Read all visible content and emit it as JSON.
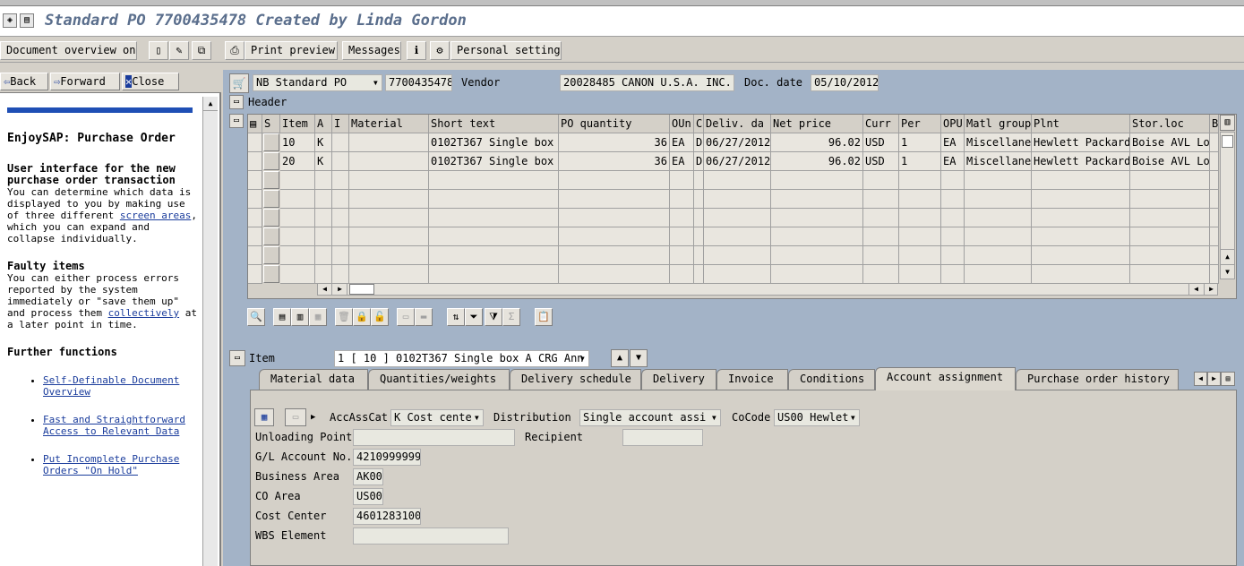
{
  "window": {
    "title": "Standard PO 7700435478 Created by Linda Gordon"
  },
  "toolbar": {
    "document_overview": "Document overview on",
    "print_preview": "Print preview",
    "messages": "Messages",
    "personal_setting": "Personal setting"
  },
  "helpnav": {
    "back": "Back",
    "forward": "Forward",
    "close": "Close"
  },
  "help": {
    "title": "EnjoySAP: Purchase Order",
    "s1_head": "User interface for the new purchase order transaction",
    "s1_text_a": "You can determine which data is displayed to you by making use of three different ",
    "s1_link": "screen areas",
    "s1_text_b": ", which you can expand and collapse individually.",
    "s2_head": "Faulty items",
    "s2_text_a": "You can either process errors reported by the system immediately or \"save them up\" and process them ",
    "s2_link": "collectively",
    "s2_text_b": " at a later point in time.",
    "s3_head": "Further functions",
    "links": [
      "Self-Definable Document Overview",
      "Fast and Straightforward Access to Relevant Data",
      "Put Incomplete Purchase Orders \"On Hold\""
    ]
  },
  "header": {
    "doc_type": "NB Standard PO",
    "po_number": "7700435478",
    "vendor_label": "Vendor",
    "vendor_value": "20028485 CANON U.S.A. INC.",
    "docdate_label": "Doc. date",
    "docdate_value": "05/10/2012",
    "header_label": "Header"
  },
  "grid": {
    "columns": [
      "S",
      "Item",
      "A",
      "I",
      "Material",
      "Short text",
      "PO quantity",
      "OUn",
      "C",
      "Deliv. da",
      "Net price",
      "Curr",
      "Per",
      "OPU",
      "Matl group",
      "Plnt",
      "Stor.loc",
      "B"
    ],
    "rows": [
      [
        "",
        "10",
        "K",
        "",
        "",
        "0102T367 Single box A",
        "36",
        "EA",
        "D",
        "06/27/2012",
        "96.02",
        "USD",
        "1",
        "EA",
        "Miscellaneo",
        "Hewlett Packard",
        "Boise AVL Loc",
        ""
      ],
      [
        "",
        "20",
        "K",
        "",
        "",
        "0102T367 Single box A",
        "36",
        "EA",
        "D",
        "06/27/2012",
        "96.02",
        "USD",
        "1",
        "EA",
        "Miscellaneo",
        "Hewlett Packard",
        "Boise AVL Loc",
        ""
      ]
    ]
  },
  "item": {
    "label": "Item",
    "selector": "1 [ 10 ] 0102T367 Single box A CRG Ann"
  },
  "tabs": [
    "Material data",
    "Quantities/weights",
    "Delivery schedule",
    "Delivery",
    "Invoice",
    "Conditions",
    "Account assignment",
    "Purchase order history"
  ],
  "account": {
    "accasscat_label": "AccAssCat",
    "accasscat_value": "K Cost cente",
    "distribution_label": "Distribution",
    "distribution_value": "Single account assi",
    "cocode_label": "CoCode",
    "cocode_value": "US00 Hewlet",
    "unloading_label": "Unloading Point",
    "unloading_value": "",
    "recipient_label": "Recipient",
    "recipient_value": "",
    "gl_label": "G/L Account No.",
    "gl_value": "4210999999",
    "ba_label": "Business Area",
    "ba_value": "AK00",
    "co_label": "CO Area",
    "co_value": "US00",
    "cc_label": "Cost Center",
    "cc_value": "4601283100",
    "wbs_label": "WBS Element",
    "wbs_value": ""
  },
  "colors": {
    "main_bg": "#a3b3c7",
    "title": "#5a6e8c",
    "help_bar": "#1f4fb5"
  }
}
